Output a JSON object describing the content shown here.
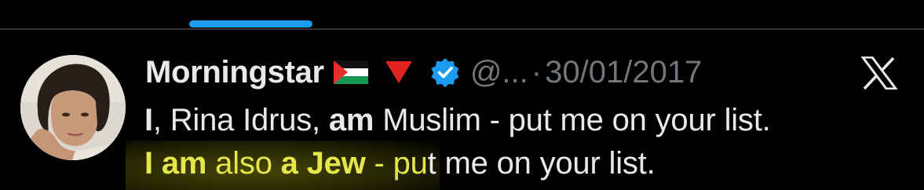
{
  "tweet": {
    "display_name": "Morningstar",
    "handle": "@...",
    "separator": "·",
    "date": "30/01/2017",
    "line1": {
      "part_bold_1": "I",
      "part_2": ", Rina Idrus, ",
      "part_bold_3": "am",
      "part_4": " Muslim - put me on your list."
    },
    "line2": {
      "part_bold_1": "I am",
      "part_2": " also ",
      "part_bold_3": "a Jew",
      "part_4": " - pu",
      "part_5": "t me on your list."
    }
  },
  "icons": {
    "flag": "palestine-flag-icon",
    "triangle": "red-triangle-icon",
    "verified": "verified-badge-icon",
    "logo": "x-logo-icon"
  },
  "colors": {
    "background": "#000000",
    "text": "#e7e9ea",
    "muted": "#71767b",
    "accent": "#1d9bf0",
    "highlight_text": "#e5e64a"
  }
}
